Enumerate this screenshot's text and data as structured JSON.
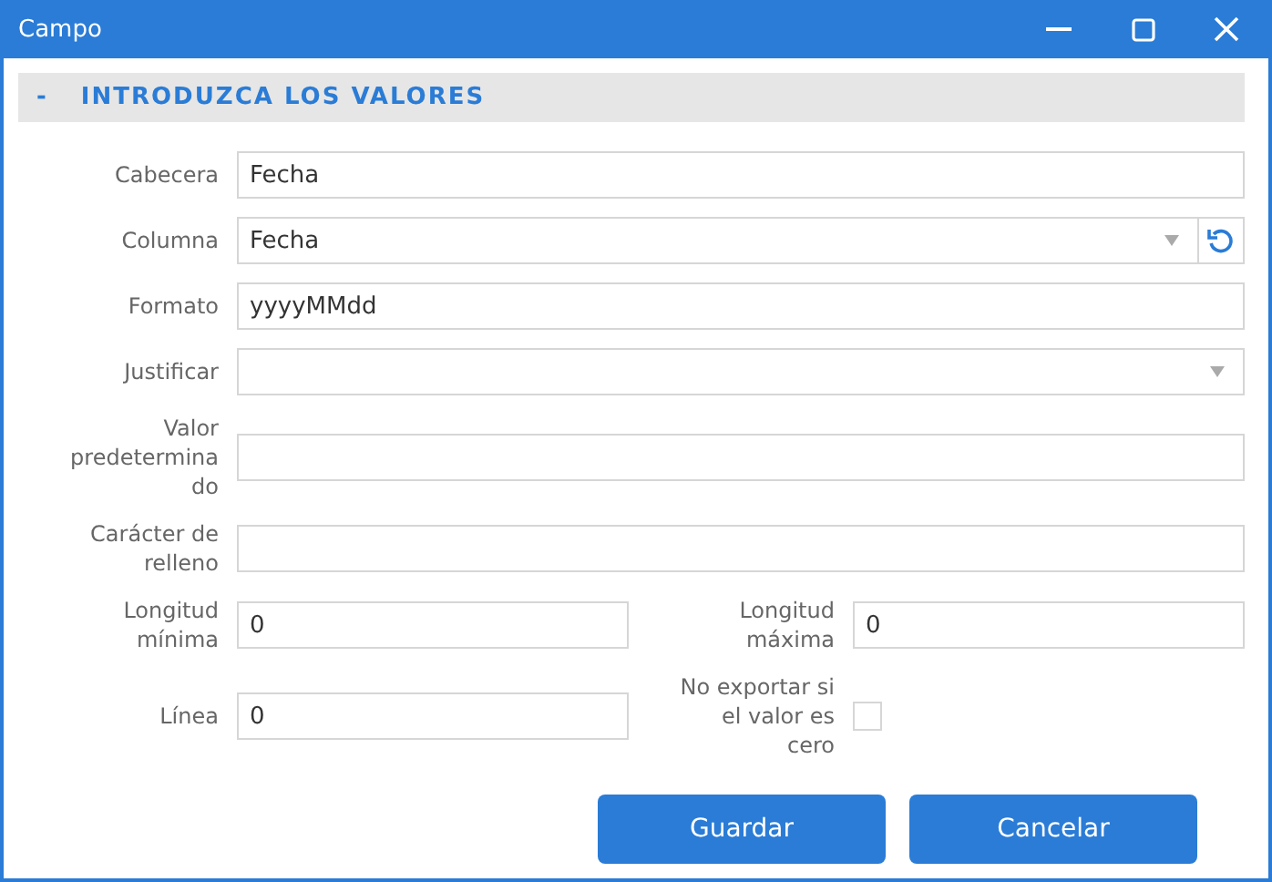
{
  "window": {
    "title": "Campo"
  },
  "section": {
    "toggle": "-",
    "title": "INTRODUZCA LOS VALORES",
    "expanded": true
  },
  "rows": [
    {
      "fields": [
        {
          "label": "Cabecera",
          "kind": "text",
          "value": "Fecha"
        }
      ]
    },
    {
      "fields": [
        {
          "label": "Columna",
          "kind": "select-reset",
          "value": "Fecha"
        }
      ]
    },
    {
      "fields": [
        {
          "label": "Formato",
          "kind": "text",
          "value": "yyyyMMdd"
        }
      ]
    },
    {
      "fields": [
        {
          "label": "Justificar",
          "kind": "select"
        }
      ]
    },
    {
      "fields": [
        {
          "label": "Valor predeterminado",
          "kind": "text"
        }
      ]
    },
    {
      "fields": [
        {
          "label": "Carácter de relleno",
          "kind": "text"
        }
      ]
    },
    {
      "fields": [
        {
          "label": "Longitud mínima",
          "kind": "text",
          "value": "0"
        },
        {
          "label": "Longitud máxima",
          "kind": "text",
          "value": "0"
        }
      ]
    },
    {
      "fields": [
        {
          "label": "Línea",
          "kind": "text",
          "value": "0"
        },
        {
          "label": "No exportar si el valor es cero",
          "kind": "checkbox",
          "checked": false
        }
      ]
    }
  ],
  "buttons": [
    "Guardar",
    "Cancelar"
  ]
}
